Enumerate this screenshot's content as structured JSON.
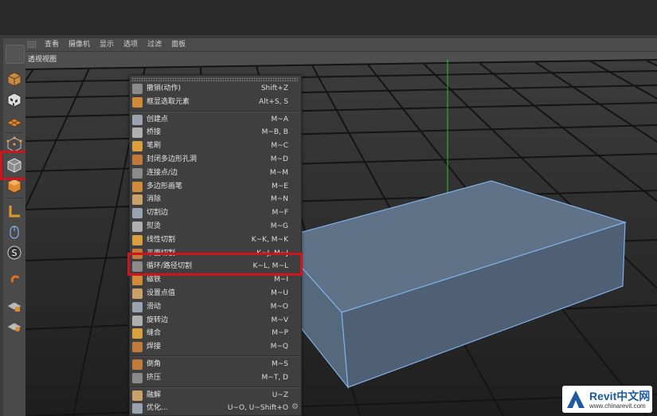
{
  "menubar": {
    "items": [
      "查看",
      "摄像机",
      "显示",
      "选项",
      "过滤",
      "面板"
    ]
  },
  "viewport": {
    "label": "透视视图"
  },
  "context_menu": {
    "groups": [
      [
        {
          "label": "撤销(动作)",
          "shortcut": "Shift+Z",
          "icon": "undo-icon"
        },
        {
          "label": "框显选取元素",
          "shortcut": "Alt+S, S",
          "icon": "frame-selection-icon"
        }
      ],
      [
        {
          "label": "创建点",
          "shortcut": "M~A",
          "icon": "create-point-icon"
        },
        {
          "label": "桥接",
          "shortcut": "M~B, B",
          "icon": "bridge-icon"
        },
        {
          "label": "笔刷",
          "shortcut": "M~C",
          "icon": "brush-icon"
        },
        {
          "label": "封闭多边形孔洞",
          "shortcut": "M~D",
          "icon": "close-hole-icon"
        },
        {
          "label": "连接点/边",
          "shortcut": "M~M",
          "icon": "connect-icon"
        },
        {
          "label": "多边形画笔",
          "shortcut": "M~E",
          "icon": "polygon-pen-icon"
        },
        {
          "label": "消除",
          "shortcut": "M~N",
          "icon": "dissolve-icon"
        },
        {
          "label": "切割边",
          "shortcut": "M~F",
          "icon": "edge-cut-icon"
        },
        {
          "label": "熨烫",
          "shortcut": "M~G",
          "icon": "iron-icon"
        },
        {
          "label": "线性切割",
          "shortcut": "K~K, M~K",
          "icon": "line-cut-icon"
        },
        {
          "label": "平面切割",
          "shortcut": "K~J, M~J",
          "icon": "plane-cut-icon"
        },
        {
          "label": "循环/路径切割",
          "shortcut": "K~L, M~L",
          "icon": "loop-cut-icon"
        },
        {
          "label": "磁铁",
          "shortcut": "M~I",
          "icon": "magnet-icon"
        },
        {
          "label": "设置点值",
          "shortcut": "M~U",
          "icon": "set-point-value-icon"
        },
        {
          "label": "滑动",
          "shortcut": "M~O",
          "icon": "slide-icon"
        },
        {
          "label": "旋转边",
          "shortcut": "M~V",
          "icon": "spin-edge-icon"
        },
        {
          "label": "缝合",
          "shortcut": "M~P",
          "icon": "stitch-icon"
        },
        {
          "label": "焊接",
          "shortcut": "M~Q",
          "icon": "weld-icon"
        }
      ],
      [
        {
          "label": "倒角",
          "shortcut": "M~S",
          "icon": "bevel-icon"
        },
        {
          "label": "挤压",
          "shortcut": "M~T, D",
          "icon": "extrude-icon"
        }
      ],
      [
        {
          "label": "融解",
          "shortcut": "U~Z",
          "icon": "melt-icon"
        },
        {
          "label": "优化...",
          "shortcut": "U~O, U~Shift+O",
          "icon": "optimize-icon"
        }
      ]
    ]
  },
  "watermark": {
    "brand": "Revit中文网",
    "url": "www.chinarevit.com"
  },
  "colors": {
    "highlight": "#d0141b",
    "object_edge": "#7fb0e8",
    "axis": "#2fbf2f"
  }
}
